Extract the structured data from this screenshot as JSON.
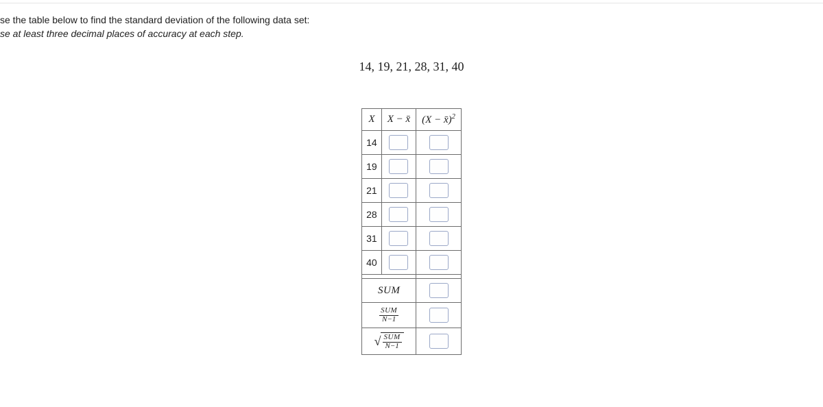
{
  "instruction_line1": "se the table below to find the standard deviation of the following data set:",
  "instruction_line2": "se at least three decimal places of accuracy at each step.",
  "dataset_display": "14, 19, 21, 28, 31, 40",
  "headers": {
    "col1": "X",
    "col2": "X − x̄",
    "col3": "(X − x̄)²"
  },
  "rows": [
    "14",
    "19",
    "21",
    "28",
    "31",
    "40"
  ],
  "summary": {
    "sum_label": "SUM",
    "sum_over_n_num": "SUM",
    "sum_over_n_den": "N−1",
    "sqrt_num": "SUM",
    "sqrt_den": "N−1"
  }
}
